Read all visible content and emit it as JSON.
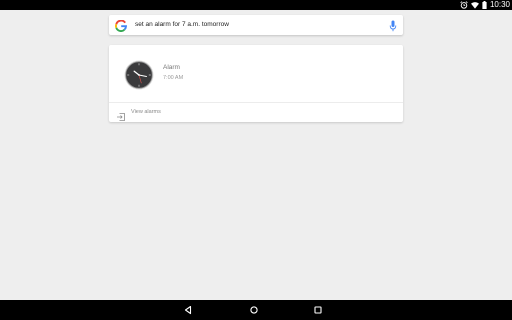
{
  "status_bar": {
    "time": "10:30",
    "icons": [
      "alarm-icon",
      "wifi-icon",
      "battery-icon"
    ]
  },
  "search": {
    "query": "set an alarm for 7 a.m. tomorrow",
    "logo": "google-g-icon",
    "mic": "microphone-icon"
  },
  "alarm_card": {
    "title": "Alarm",
    "time": "7:00 AM",
    "icon": "clock-icon",
    "view_alarms_label": "View alarms",
    "view_alarms_icon": "open-in-app-icon"
  },
  "nav_bar": {
    "buttons": [
      "back-icon",
      "home-icon",
      "recents-icon"
    ]
  },
  "colors": {
    "background": "#eeeeee",
    "bars": "#000000",
    "card": "#ffffff",
    "clock_face": "#3a3a3c",
    "clock_second_hand": "#e0524f",
    "mic_blue": "#4285f4"
  }
}
